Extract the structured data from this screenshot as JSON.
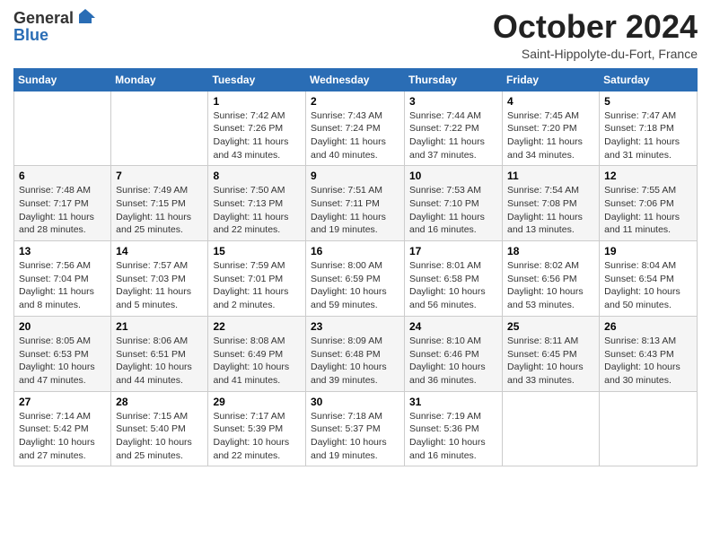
{
  "header": {
    "logo_general": "General",
    "logo_blue": "Blue",
    "month_title": "October 2024",
    "location": "Saint-Hippolyte-du-Fort, France"
  },
  "weekdays": [
    "Sunday",
    "Monday",
    "Tuesday",
    "Wednesday",
    "Thursday",
    "Friday",
    "Saturday"
  ],
  "weeks": [
    [
      {
        "day": "",
        "info": ""
      },
      {
        "day": "",
        "info": ""
      },
      {
        "day": "1",
        "info": "Sunrise: 7:42 AM\nSunset: 7:26 PM\nDaylight: 11 hours\nand 43 minutes."
      },
      {
        "day": "2",
        "info": "Sunrise: 7:43 AM\nSunset: 7:24 PM\nDaylight: 11 hours\nand 40 minutes."
      },
      {
        "day": "3",
        "info": "Sunrise: 7:44 AM\nSunset: 7:22 PM\nDaylight: 11 hours\nand 37 minutes."
      },
      {
        "day": "4",
        "info": "Sunrise: 7:45 AM\nSunset: 7:20 PM\nDaylight: 11 hours\nand 34 minutes."
      },
      {
        "day": "5",
        "info": "Sunrise: 7:47 AM\nSunset: 7:18 PM\nDaylight: 11 hours\nand 31 minutes."
      }
    ],
    [
      {
        "day": "6",
        "info": "Sunrise: 7:48 AM\nSunset: 7:17 PM\nDaylight: 11 hours\nand 28 minutes."
      },
      {
        "day": "7",
        "info": "Sunrise: 7:49 AM\nSunset: 7:15 PM\nDaylight: 11 hours\nand 25 minutes."
      },
      {
        "day": "8",
        "info": "Sunrise: 7:50 AM\nSunset: 7:13 PM\nDaylight: 11 hours\nand 22 minutes."
      },
      {
        "day": "9",
        "info": "Sunrise: 7:51 AM\nSunset: 7:11 PM\nDaylight: 11 hours\nand 19 minutes."
      },
      {
        "day": "10",
        "info": "Sunrise: 7:53 AM\nSunset: 7:10 PM\nDaylight: 11 hours\nand 16 minutes."
      },
      {
        "day": "11",
        "info": "Sunrise: 7:54 AM\nSunset: 7:08 PM\nDaylight: 11 hours\nand 13 minutes."
      },
      {
        "day": "12",
        "info": "Sunrise: 7:55 AM\nSunset: 7:06 PM\nDaylight: 11 hours\nand 11 minutes."
      }
    ],
    [
      {
        "day": "13",
        "info": "Sunrise: 7:56 AM\nSunset: 7:04 PM\nDaylight: 11 hours\nand 8 minutes."
      },
      {
        "day": "14",
        "info": "Sunrise: 7:57 AM\nSunset: 7:03 PM\nDaylight: 11 hours\nand 5 minutes."
      },
      {
        "day": "15",
        "info": "Sunrise: 7:59 AM\nSunset: 7:01 PM\nDaylight: 11 hours\nand 2 minutes."
      },
      {
        "day": "16",
        "info": "Sunrise: 8:00 AM\nSunset: 6:59 PM\nDaylight: 10 hours\nand 59 minutes."
      },
      {
        "day": "17",
        "info": "Sunrise: 8:01 AM\nSunset: 6:58 PM\nDaylight: 10 hours\nand 56 minutes."
      },
      {
        "day": "18",
        "info": "Sunrise: 8:02 AM\nSunset: 6:56 PM\nDaylight: 10 hours\nand 53 minutes."
      },
      {
        "day": "19",
        "info": "Sunrise: 8:04 AM\nSunset: 6:54 PM\nDaylight: 10 hours\nand 50 minutes."
      }
    ],
    [
      {
        "day": "20",
        "info": "Sunrise: 8:05 AM\nSunset: 6:53 PM\nDaylight: 10 hours\nand 47 minutes."
      },
      {
        "day": "21",
        "info": "Sunrise: 8:06 AM\nSunset: 6:51 PM\nDaylight: 10 hours\nand 44 minutes."
      },
      {
        "day": "22",
        "info": "Sunrise: 8:08 AM\nSunset: 6:49 PM\nDaylight: 10 hours\nand 41 minutes."
      },
      {
        "day": "23",
        "info": "Sunrise: 8:09 AM\nSunset: 6:48 PM\nDaylight: 10 hours\nand 39 minutes."
      },
      {
        "day": "24",
        "info": "Sunrise: 8:10 AM\nSunset: 6:46 PM\nDaylight: 10 hours\nand 36 minutes."
      },
      {
        "day": "25",
        "info": "Sunrise: 8:11 AM\nSunset: 6:45 PM\nDaylight: 10 hours\nand 33 minutes."
      },
      {
        "day": "26",
        "info": "Sunrise: 8:13 AM\nSunset: 6:43 PM\nDaylight: 10 hours\nand 30 minutes."
      }
    ],
    [
      {
        "day": "27",
        "info": "Sunrise: 7:14 AM\nSunset: 5:42 PM\nDaylight: 10 hours\nand 27 minutes."
      },
      {
        "day": "28",
        "info": "Sunrise: 7:15 AM\nSunset: 5:40 PM\nDaylight: 10 hours\nand 25 minutes."
      },
      {
        "day": "29",
        "info": "Sunrise: 7:17 AM\nSunset: 5:39 PM\nDaylight: 10 hours\nand 22 minutes."
      },
      {
        "day": "30",
        "info": "Sunrise: 7:18 AM\nSunset: 5:37 PM\nDaylight: 10 hours\nand 19 minutes."
      },
      {
        "day": "31",
        "info": "Sunrise: 7:19 AM\nSunset: 5:36 PM\nDaylight: 10 hours\nand 16 minutes."
      },
      {
        "day": "",
        "info": ""
      },
      {
        "day": "",
        "info": ""
      }
    ]
  ]
}
